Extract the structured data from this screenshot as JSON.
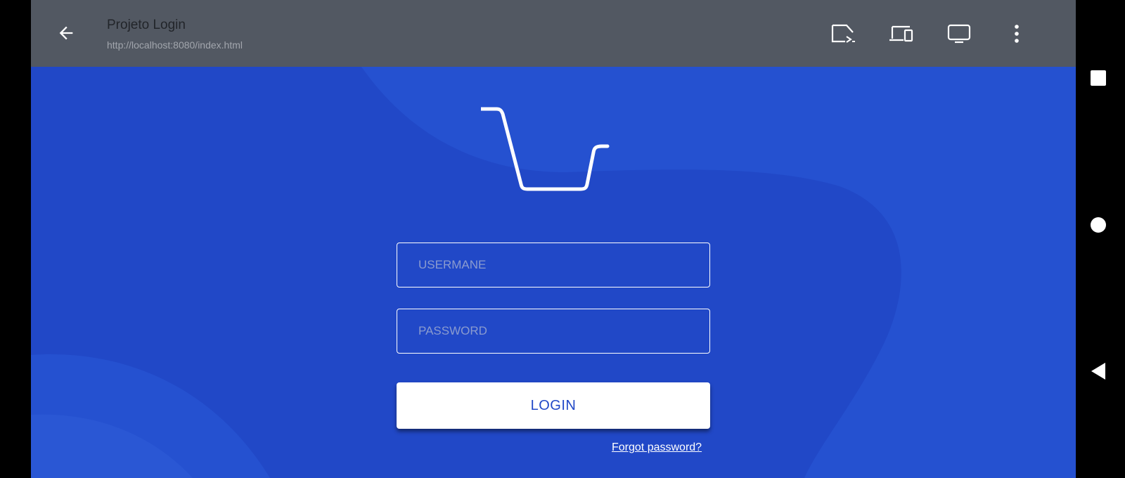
{
  "toolbar": {
    "title": "Projeto Login",
    "url": "http://localhost:8080/index.html",
    "icons": [
      "back-arrow-icon",
      "screen-share-icon",
      "devices-icon",
      "monitor-icon",
      "more-vert-icon"
    ]
  },
  "form": {
    "username_placeholder": "USERMANE",
    "password_placeholder": "PASSWORD",
    "login_label": "LOGIN",
    "forgot_label": "Forgot password?"
  },
  "system_nav": {
    "icons": [
      "recents-square-icon",
      "home-circle-icon",
      "back-triangle-icon"
    ]
  },
  "colors": {
    "toolbar": "#525862",
    "background": "#2148c7",
    "button": "#ffffff",
    "accent_text": "#2148c7"
  }
}
